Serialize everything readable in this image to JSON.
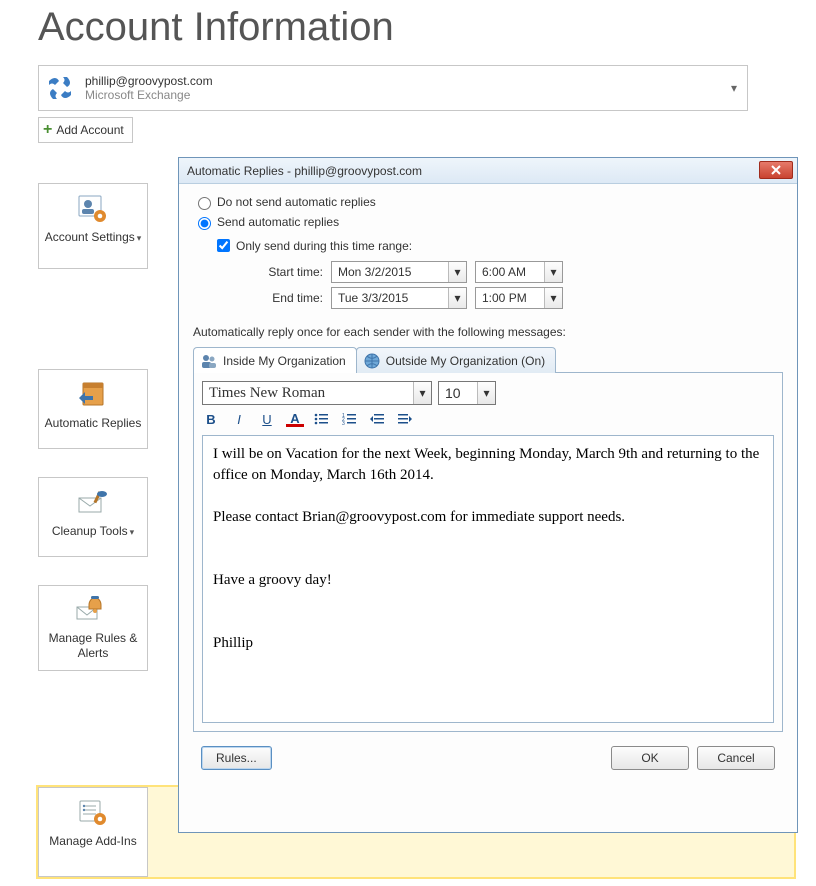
{
  "page": {
    "title": "Account Information"
  },
  "account": {
    "email": "phillip@groovypost.com",
    "subtitle": "Microsoft Exchange"
  },
  "add_account_label": "Add Account",
  "sidebar": [
    {
      "label": "Account Settings",
      "has_menu": true
    },
    {
      "label": "Automatic Replies",
      "has_menu": false
    },
    {
      "label": "Cleanup Tools",
      "has_menu": true
    },
    {
      "label": "Manage Rules & Alerts",
      "has_menu": false
    },
    {
      "label": "Manage Add-Ins",
      "has_menu": false
    }
  ],
  "dialog": {
    "title": "Automatic Replies -  phillip@groovypost.com",
    "radio_dont_send": "Do not send automatic replies",
    "radio_send": "Send automatic replies",
    "selected": "send",
    "only_range": {
      "label": "Only send during this time range:",
      "checked": true
    },
    "start_label": "Start time:",
    "end_label": "End time:",
    "start_date": "Mon 3/2/2015",
    "start_time": "6:00 AM",
    "end_date": "Tue 3/3/2015",
    "end_time": "1:00 PM",
    "reply_label": "Automatically reply once for each sender with the following messages:",
    "tabs": {
      "inside": "Inside My Organization",
      "outside": "Outside My Organization (On)"
    },
    "font": {
      "name": "Times New Roman",
      "size": "10"
    },
    "format_labels": {
      "bold": "B",
      "italic": "I",
      "underline": "U",
      "font_color": "A"
    },
    "message": "I will be on Vacation for the next Week, beginning Monday, March 9th and returning to the office on Monday, March 16th 2014.\n\nPlease contact Brian@groovypost.com for immediate support needs.\n\n\nHave a groovy day!\n\n\nPhillip",
    "buttons": {
      "rules": "Rules...",
      "ok": "OK",
      "cancel": "Cancel"
    }
  }
}
